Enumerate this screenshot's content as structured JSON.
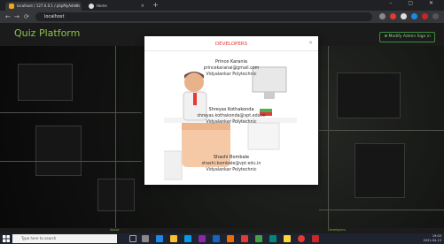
{
  "browser": {
    "tabs": [
      {
        "label": "localhost / 127.0.0.1 / phpMyAdmin"
      },
      {
        "label": "Home"
      }
    ],
    "url": "localhost",
    "new_tab": "+",
    "window_controls": "–  ▢  ✕",
    "nav": {
      "back": "←",
      "forward": "→",
      "reload": "⟳"
    }
  },
  "app": {
    "brand": "Quiz Platform",
    "header_button": "⊕ Modify Admin Sign in"
  },
  "modal": {
    "title": "DEVELOPERS",
    "close": "×",
    "developers": [
      {
        "name": "Prince Karania",
        "email": "princekaranai@gmail.com",
        "college": "Vidyalankar Polytechnic"
      },
      {
        "name": "Shreyas Kothakonda",
        "email": "shreyas.kothakonda@vpt.edu.in",
        "college": "Vidyalankar Polytechnic"
      },
      {
        "name": "Shashi Bombale",
        "email": "shashi.bombale@vpt.edu.in",
        "college": "Vidyalankar Polytechnic"
      }
    ]
  },
  "footer": {
    "left": "About",
    "right": "Developers"
  },
  "taskbar": {
    "search_placeholder": "Type here to search",
    "time": "19:03",
    "date": "2021-04-13"
  }
}
